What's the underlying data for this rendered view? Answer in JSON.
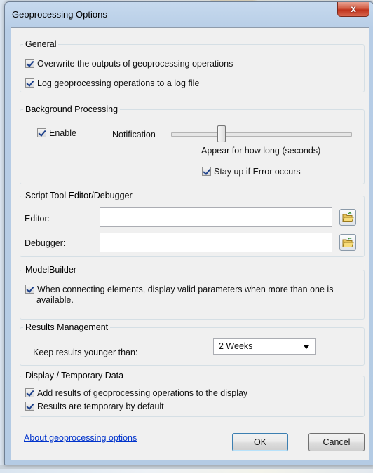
{
  "window": {
    "title": "Geoprocessing Options",
    "close_glyph": "x"
  },
  "general": {
    "legend": "General",
    "overwrite": {
      "label": "Overwrite the outputs of geoprocessing operations",
      "checked": true
    },
    "log": {
      "label": "Log geoprocessing operations to a log file",
      "checked": true
    }
  },
  "background": {
    "legend": "Background Processing",
    "enable": {
      "label": "Enable",
      "checked": true
    },
    "notification_label": "Notification",
    "appear_label": "Appear for how long (seconds)",
    "stay_up": {
      "label": "Stay up if Error occurs",
      "checked": true
    }
  },
  "script": {
    "legend": "Script Tool Editor/Debugger",
    "editor_label": "Editor:",
    "editor_value": "",
    "debugger_label": "Debugger:",
    "debugger_value": ""
  },
  "modelbuilder": {
    "legend": "ModelBuilder",
    "option_line1": "When connecting elements, display valid parameters when more than one is",
    "option_line2": "available.",
    "checked": true
  },
  "results": {
    "legend": "Results Management",
    "keep_label": "Keep results younger than:",
    "keep_value": "2 Weeks"
  },
  "display": {
    "legend": "Display / Temporary Data",
    "add_results": {
      "label": "Add results of geoprocessing operations to the display",
      "checked": true
    },
    "temporary": {
      "label": "Results are temporary by default",
      "checked": true
    }
  },
  "footer": {
    "about_link": "About geoprocessing options",
    "ok_label": "OK",
    "cancel_label": "Cancel"
  },
  "colors": {
    "accent": "#0033cc",
    "close": "#c0331c"
  },
  "icons": {
    "browse": "folder-open-icon",
    "dropdown": "chevron-down-icon",
    "checkbox": "checkmark-icon"
  }
}
